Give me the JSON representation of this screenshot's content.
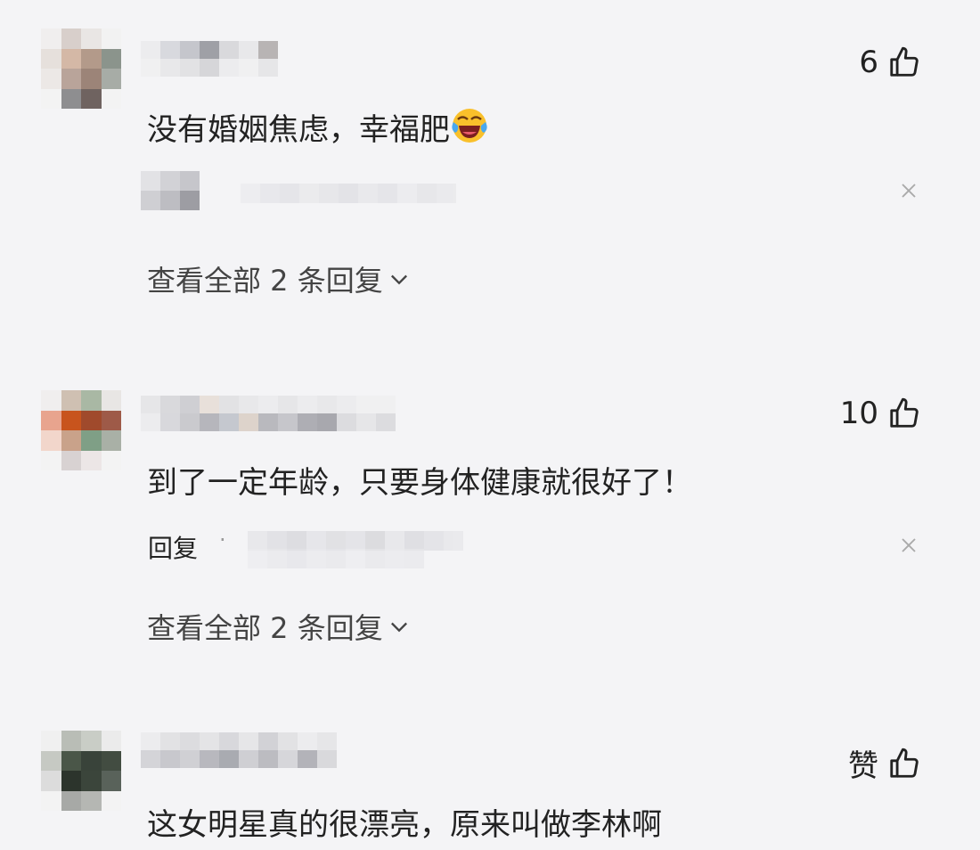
{
  "comments": [
    {
      "like_label": "6",
      "text": "没有婚姻焦虑，幸福肥",
      "emoji": "laughing-tears-emoji",
      "view_all": "查看全部 2 条回复"
    },
    {
      "like_label": "10",
      "text": "到了一定年龄，只要身体健康就很好了！",
      "reply_label": "回复",
      "reply_sep": "·",
      "view_all": "查看全部 2 条回复"
    },
    {
      "like_label": "赞",
      "text": "这女明星真的很漂亮，原来叫做李林啊"
    }
  ],
  "icons": {
    "like": "thumbs-up-icon",
    "close": "close-icon",
    "expand": "chevron-down-icon"
  },
  "colors": {
    "background": "#f4f4f6",
    "text": "#222222",
    "secondary": "#444444"
  }
}
